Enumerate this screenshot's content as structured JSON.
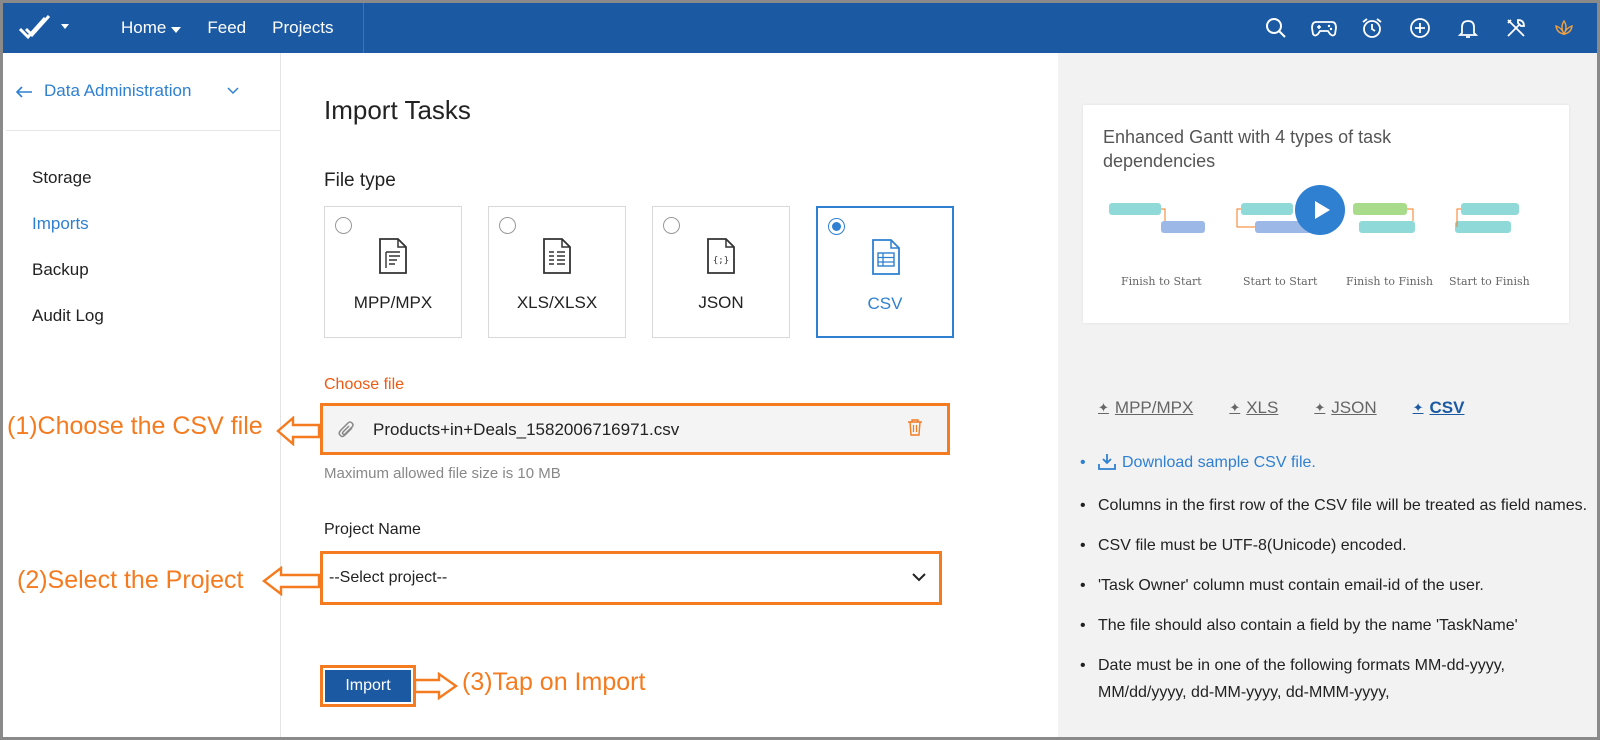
{
  "topbar": {
    "nav": [
      "Home",
      "Feed",
      "Projects"
    ]
  },
  "sidebar": {
    "title": "Data Administration",
    "items": [
      {
        "label": "Storage"
      },
      {
        "label": "Imports"
      },
      {
        "label": "Backup"
      },
      {
        "label": "Audit Log"
      }
    ]
  },
  "main": {
    "title": "Import Tasks",
    "file_type_label": "File type",
    "file_types": [
      {
        "label": "MPP/MPX"
      },
      {
        "label": "XLS/XLSX"
      },
      {
        "label": "JSON"
      },
      {
        "label": "CSV"
      }
    ],
    "selected_type": "CSV",
    "choose_file_label": "Choose file",
    "file_name": "Products+in+Deals_1582006716971.csv",
    "max_size_note": "Maximum allowed file size is 10 MB",
    "project_label": "Project Name",
    "project_value": "--Select project--",
    "import_label": "Import"
  },
  "annotations": {
    "step1": "(1)Choose the CSV file",
    "step2": "(2)Select the Project",
    "step3": "(3)Tap on Import"
  },
  "right": {
    "promo_title": "Enhanced Gantt with 4 types of task dependencies",
    "dependency_types": [
      "Finish to Start",
      "Start to Start",
      "Finish to Finish",
      "Start to Finish"
    ],
    "format_tabs": [
      "MPP/MPX",
      "XLS",
      "JSON",
      "CSV"
    ],
    "active_format": "CSV",
    "download_link": "Download sample CSV file.",
    "rules": [
      "Columns in the first row of the CSV file will be treated as field names.",
      "CSV file must be UTF-8(Unicode) encoded.",
      "'Task Owner' column must contain email-id of the user.",
      "The file should also contain a field by the name 'TaskName'",
      "Date must be in one of the following formats MM-dd-yyyy, MM/dd/yyyy, dd-MM-yyyy, dd-MMM-yyyy,"
    ]
  },
  "colors": {
    "brand": "#1b5aa3",
    "accent": "#2f80d1",
    "annotation": "#f47b20"
  }
}
